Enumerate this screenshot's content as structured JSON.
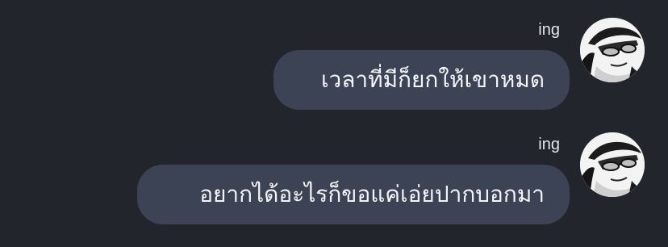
{
  "chat": {
    "messages": [
      {
        "sender": "ing",
        "text": "เวลาที่มีก็ยกให้เขาหมด",
        "avatar_icon": "user-avatar-icon"
      },
      {
        "sender": "ing",
        "text": "อยากได้อะไรก็ขอแค่เอ่ยปากบอกมา",
        "avatar_icon": "user-avatar-icon"
      }
    ]
  },
  "colors": {
    "background": "#23252d",
    "bubble": "#3c4354",
    "text": "#f4f5f8"
  }
}
